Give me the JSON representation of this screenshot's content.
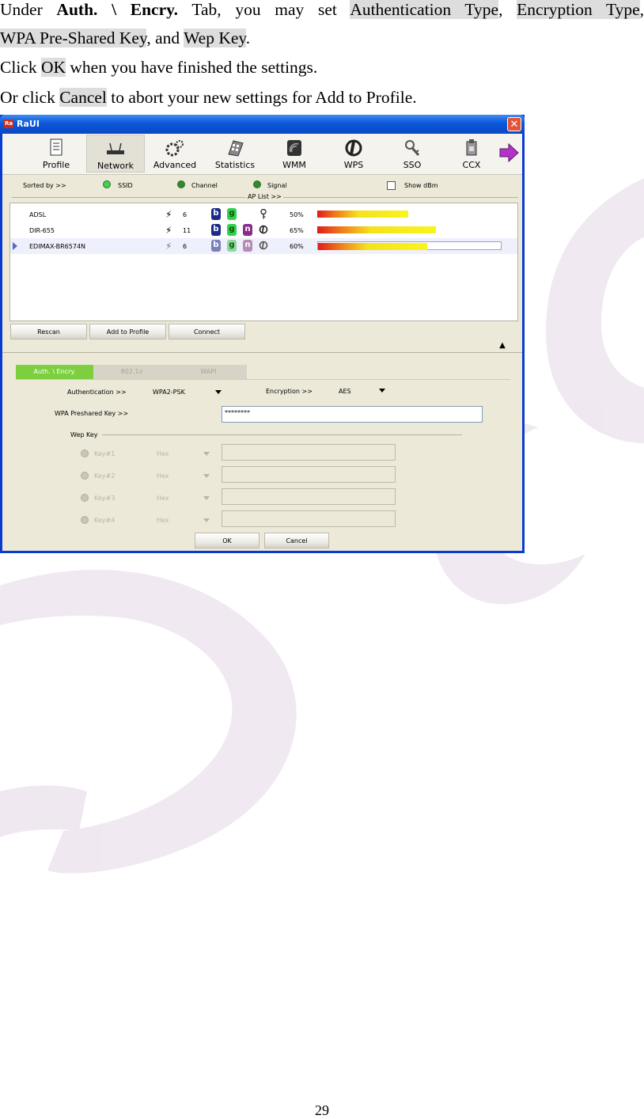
{
  "doc": {
    "para1": {
      "pre1": "Under ",
      "bold1": "Auth. \\ Encry.",
      "mid1": " Tab, you may set ",
      "hl1": "Authentication Type",
      "sep1": ", ",
      "hl2": "Encryption Type",
      "sep2": ",",
      "hl3": "WPA Pre-Shared Key",
      "sep3": ", and ",
      "hl4": "Wep Key",
      "end": "."
    },
    "para2": {
      "pre": "Click ",
      "hl": "OK",
      "post": " when you have finished the settings."
    },
    "para3": {
      "pre": "Or click ",
      "hl": "Cancel",
      "post": " to abort your new settings for Add to Profile."
    },
    "page_number": "29"
  },
  "window": {
    "title": "RaUI",
    "app_icon_text": "Ra",
    "close_glyph": "✕",
    "toolbar": [
      {
        "label": "Profile",
        "icon": "profile-icon"
      },
      {
        "label": "Network",
        "icon": "network-icon",
        "active": true
      },
      {
        "label": "Advanced",
        "icon": "advanced-icon"
      },
      {
        "label": "Statistics",
        "icon": "statistics-icon"
      },
      {
        "label": "WMM",
        "icon": "wmm-icon"
      },
      {
        "label": "WPS",
        "icon": "wps-icon"
      },
      {
        "label": "SSO",
        "icon": "sso-icon"
      },
      {
        "label": "CCX",
        "icon": "ccx-icon"
      }
    ],
    "sort": {
      "sorted_by": "Sorted by >>",
      "ssid": "SSID",
      "channel": "Channel",
      "signal": "Signal",
      "show_dbm": "Show dBm",
      "ap_list": "AP List >>"
    },
    "aps": [
      {
        "ssid": "ADSL",
        "channel": "6",
        "signal_text": "50%",
        "signal": 50,
        "modes": [
          "b",
          "g"
        ],
        "sec": "key-icon",
        "selected": false
      },
      {
        "ssid": "DIR-655",
        "channel": "11",
        "signal_text": "65%",
        "signal": 65,
        "modes": [
          "b",
          "g",
          "n"
        ],
        "sec": "wps-mini-icon",
        "selected": false
      },
      {
        "ssid": "EDIMAX-BR6574N",
        "channel": "6",
        "signal_text": "60%",
        "signal": 60,
        "modes": [
          "b",
          "g",
          "n"
        ],
        "sec": "wps-mini-icon",
        "selected": true
      }
    ],
    "mode_letters": {
      "b": "b",
      "g": "g",
      "n": "n"
    },
    "buttons": {
      "rescan": "Rescan",
      "add_to_profile": "Add to Profile",
      "connect": "Connect",
      "ok": "OK",
      "cancel": "Cancel"
    },
    "tabs": [
      "Auth. \\ Encry.",
      "802.1x",
      "WAPI"
    ],
    "auth": {
      "authentication_label": "Authentication >>",
      "authentication_value": "WPA2-PSK",
      "encryption_label": "Encryption >>",
      "encryption_value": "AES",
      "psk_label": "WPA Preshared Key >>",
      "psk_value": "********",
      "wep_key_label": "Wep Key",
      "wep_keys": [
        {
          "label": "Key#1",
          "format": "Hex"
        },
        {
          "label": "Key#2",
          "format": "Hex"
        },
        {
          "label": "Key#3",
          "format": "Hex"
        },
        {
          "label": "Key#4",
          "format": "Hex"
        }
      ]
    },
    "colors": {
      "tab_active": "#7ccf3f",
      "title_blue": "#0b57d8",
      "highlight": "#dddddd"
    }
  }
}
